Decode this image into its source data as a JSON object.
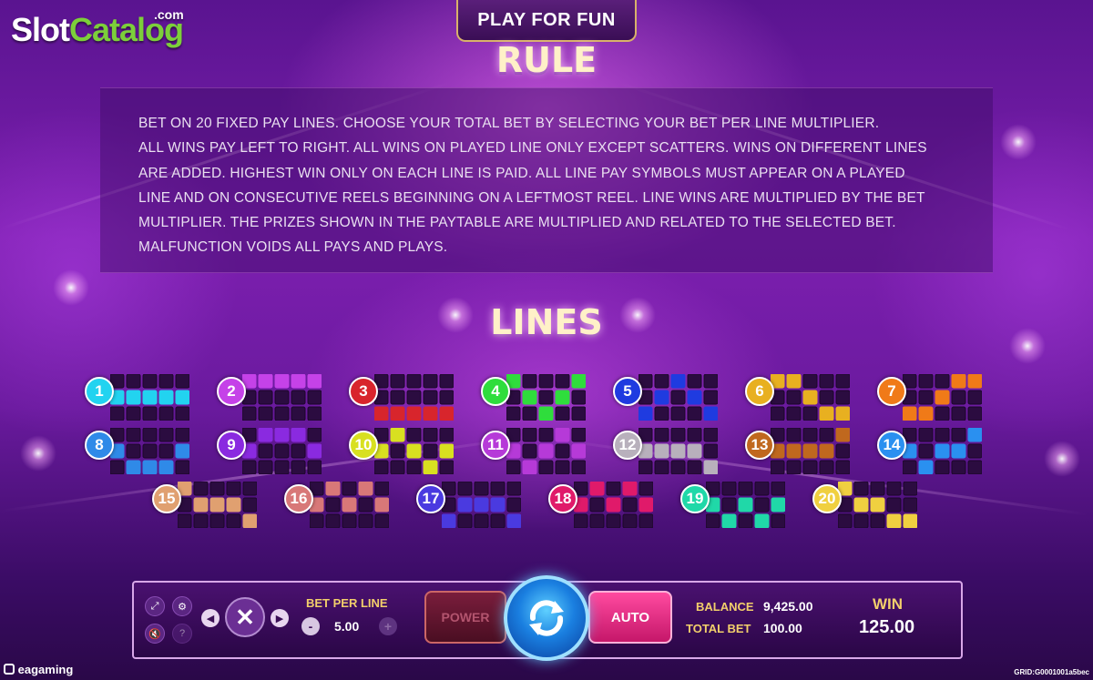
{
  "logo": {
    "part1": "Slot",
    "part2": "Catalog",
    "suffix": ".com"
  },
  "play_for_fun": "PLAY FOR FUN",
  "rule_title": "RULE",
  "rules_lines": [
    "BET ON 20 FIXED PAY LINES. CHOOSE YOUR TOTAL BET BY SELECTING YOUR BET PER LINE MULTIPLIER.",
    "ALL WINS PAY LEFT TO RIGHT. ALL WINS ON PLAYED LINE ONLY EXCEPT SCATTERS. WINS ON DIFFERENT LINES",
    "ARE ADDED. HIGHEST WIN ONLY ON EACH LINE IS PAID. ALL LINE PAY SYMBOLS MUST APPEAR ON A PLAYED",
    "LINE AND ON CONSECUTIVE REELS BEGINNING ON A LEFTMOST REEL. LINE WINS ARE MULTIPLIED BY THE BET",
    "MULTIPLIER. THE PRIZES SHOWN IN THE PAYTABLE ARE MULTIPLIED AND RELATED TO THE SELECTED BET.",
    "MALFUNCTION VOIDS ALL PAYS AND PLAYS."
  ],
  "lines_title": "LINES",
  "paylines": [
    {
      "n": "1",
      "color": "#22d3f0",
      "rows": [
        1,
        1,
        1,
        1,
        1
      ]
    },
    {
      "n": "2",
      "color": "#c542e8",
      "rows": [
        0,
        0,
        0,
        0,
        0
      ]
    },
    {
      "n": "3",
      "color": "#d8252c",
      "rows": [
        2,
        2,
        2,
        2,
        2
      ]
    },
    {
      "n": "4",
      "color": "#2fdd3c",
      "rows": [
        0,
        1,
        2,
        1,
        0
      ]
    },
    {
      "n": "5",
      "color": "#1f3be0",
      "rows": [
        2,
        1,
        0,
        1,
        2
      ]
    },
    {
      "n": "6",
      "color": "#e8b020",
      "rows": [
        0,
        0,
        1,
        2,
        2
      ]
    },
    {
      "n": "7",
      "color": "#f07a18",
      "rows": [
        2,
        2,
        1,
        0,
        0
      ]
    },
    {
      "n": "8",
      "color": "#2f8ae8",
      "rows": [
        1,
        2,
        2,
        2,
        1
      ]
    },
    {
      "n": "9",
      "color": "#8a2ae0",
      "rows": [
        1,
        0,
        0,
        0,
        1
      ]
    },
    {
      "n": "10",
      "color": "#d8e020",
      "rows": [
        1,
        0,
        1,
        2,
        1
      ]
    },
    {
      "n": "11",
      "color": "#b63ad8",
      "rows": [
        1,
        2,
        1,
        0,
        1
      ]
    },
    {
      "n": "12",
      "color": "#b8b0bc",
      "rows": [
        1,
        1,
        1,
        1,
        2
      ]
    },
    {
      "n": "13",
      "color": "#c0681e",
      "rows": [
        1,
        1,
        1,
        1,
        0
      ]
    },
    {
      "n": "14",
      "color": "#2a90f0",
      "rows": [
        1,
        2,
        1,
        1,
        0
      ]
    },
    {
      "n": "15",
      "color": "#e0a070",
      "rows": [
        0,
        1,
        1,
        1,
        2
      ]
    },
    {
      "n": "16",
      "color": "#d87878",
      "rows": [
        1,
        0,
        1,
        0,
        1
      ]
    },
    {
      "n": "17",
      "color": "#4a3ae0",
      "rows": [
        2,
        1,
        1,
        1,
        2
      ]
    },
    {
      "n": "18",
      "color": "#e01a6a",
      "rows": [
        1,
        0,
        1,
        0,
        1
      ]
    },
    {
      "n": "19",
      "color": "#20d8a8",
      "rows": [
        1,
        2,
        1,
        2,
        1
      ]
    },
    {
      "n": "20",
      "color": "#f0d040",
      "rows": [
        0,
        1,
        1,
        2,
        2
      ]
    }
  ],
  "controls": {
    "bet_per_line_label": "BET PER LINE",
    "bet_per_line_value": "5.00",
    "minus": "-",
    "plus": "+",
    "power_label": "POWER",
    "auto_label": "AUTO",
    "balance_label": "BALANCE",
    "balance_value": "9,425.00",
    "total_bet_label": "TOTAL BET",
    "total_bet_value": "100.00",
    "win_label": "WIN",
    "win_value": "125.00"
  },
  "footer": {
    "brand": "eagaming",
    "grid_id": "GRID:G0001001a5bec"
  },
  "icons": [
    "fullscreen-icon",
    "settings-icon",
    "sound-icon",
    "info-icon",
    "left-arrow-icon",
    "close-icon",
    "right-arrow-icon",
    "spin-icon"
  ]
}
